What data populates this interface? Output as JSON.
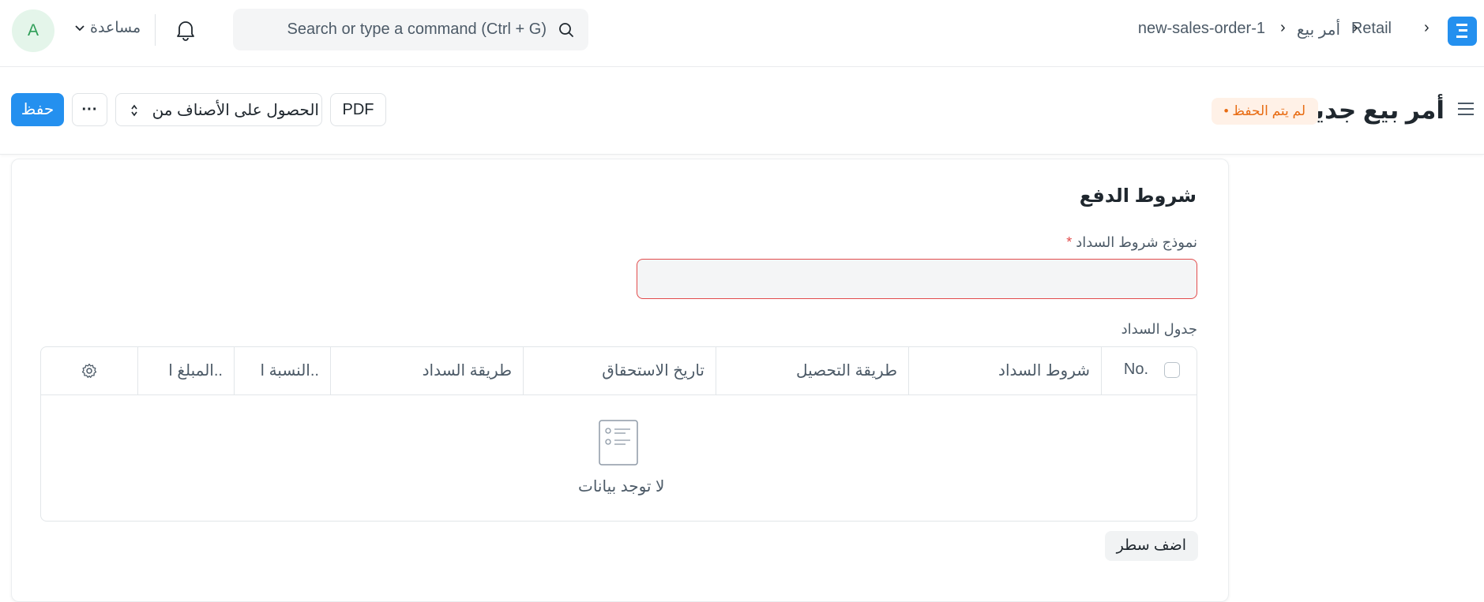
{
  "navbar": {
    "breadcrumbs": [
      "Retail",
      "أمر بيع",
      "new-sales-order-1"
    ],
    "search_placeholder": "Search or type a command (Ctrl + G)",
    "help_label": "مساعدة",
    "avatar_initial": "A"
  },
  "page": {
    "title": "أمر بيع جديد",
    "status_badge": "لم يتم الحفظ",
    "pdf_label": "PDF",
    "get_items_label": "الحصول على الأصناف من",
    "more_label": "···",
    "save_label": "حفظ"
  },
  "form": {
    "section_title": "شروط الدفع",
    "template_label": "نموذج شروط السداد",
    "template_required": "*",
    "template_value": "",
    "schedule_label": "جدول السداد",
    "columns": [
      "No.",
      "شروط السداد",
      "طريقة التحصيل",
      "تاريخ الاستحقاق",
      "طريقة السداد",
      "النسبة ا..",
      "المبلغ ا.."
    ],
    "empty_text": "لا توجد بيانات",
    "add_row_label": "اضف سطر"
  },
  "colors": {
    "primary": "#2490ef",
    "badge_text": "#e86c13",
    "badge_bg": "#fff1e7",
    "required": "#e24c4c",
    "avatar_bg": "#e4f5ea",
    "avatar_text": "#2f9e58"
  }
}
